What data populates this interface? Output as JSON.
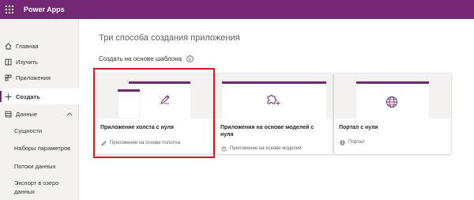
{
  "app": {
    "name": "Power Apps"
  },
  "colors": {
    "brand": "#742774",
    "highlight": "#e81123"
  },
  "sidebar": {
    "items": [
      {
        "label": "Главная",
        "icon": "home-icon"
      },
      {
        "label": "Изучить",
        "icon": "book-icon"
      },
      {
        "label": "Приложения",
        "icon": "apps-icon"
      },
      {
        "label": "Создать",
        "icon": "plus-icon",
        "active": true
      },
      {
        "label": "Данные",
        "icon": "table-icon",
        "expanded": true
      }
    ],
    "subitems": [
      {
        "label": "Сущности"
      },
      {
        "label": "Наборы параметров"
      },
      {
        "label": "Потоки данных"
      },
      {
        "label": "Экспорт в озеро данных"
      }
    ]
  },
  "main": {
    "title": "Три способа создания приложения",
    "section_label": "Создать на основе шаблона",
    "cards": [
      {
        "title": "Приложение холста с нуля",
        "meta": "Приложение на основе полотна",
        "icon": "pen-icon",
        "meta_icon": "pencil-icon"
      },
      {
        "title": "Приложения на основе моделей с нуля",
        "meta": "Приложение на основе моделей",
        "icon": "puzzle-plus-icon",
        "meta_icon": "model-icon"
      },
      {
        "title": "Портал с нуля",
        "meta": "Портал",
        "icon": "globe-icon",
        "meta_icon": "globe-small-icon"
      }
    ]
  }
}
